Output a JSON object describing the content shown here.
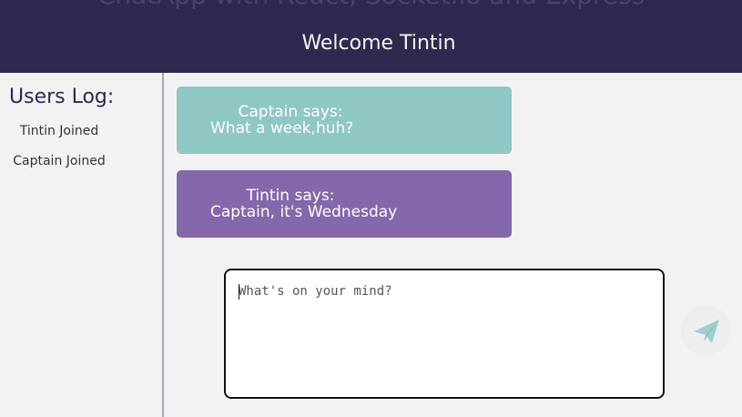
{
  "header": {
    "app_title": "ChatApp with React, Socket.io and Express",
    "welcome": "Welcome Tintin"
  },
  "users_log": {
    "title": "Users Log:",
    "entries": [
      "Tintin Joined",
      "Captain Joined"
    ]
  },
  "messages": [
    {
      "author": "Captain says:",
      "text": "What a week,huh?",
      "color": "#8fc7c5"
    },
    {
      "author": "Tintin says:",
      "text": "Captain, it's Wednesday",
      "color": "#8567ab"
    }
  ],
  "composer": {
    "placeholder": "What's on your mind?",
    "value": ""
  },
  "send_button": {
    "icon": "paper-plane-icon",
    "color": "#9fd0cd"
  },
  "colors": {
    "header_bg": "#2e2a4d",
    "page_bg": "#f2f2f2"
  }
}
